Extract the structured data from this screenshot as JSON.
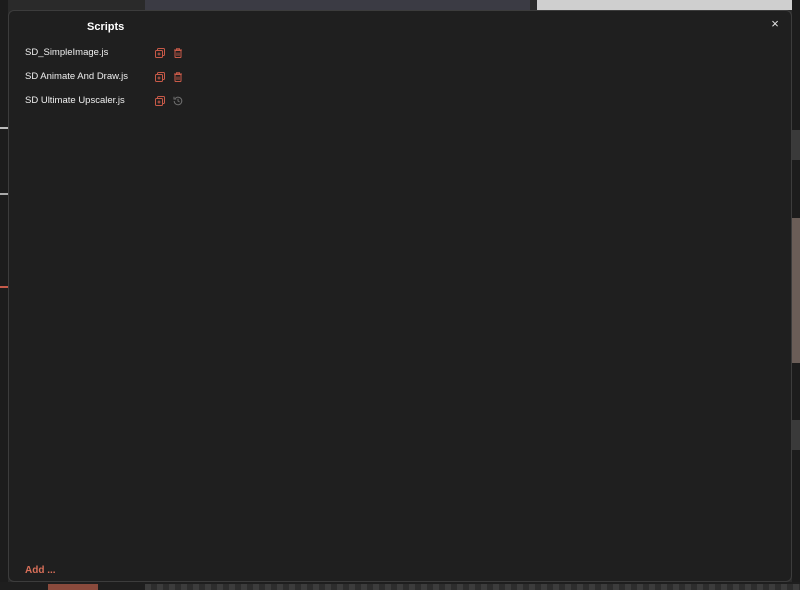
{
  "modal": {
    "title": "Scripts",
    "close_label": "×",
    "add_label": "Add ...",
    "scripts": [
      {
        "name": "SD_SimpleImage.js",
        "actions": [
          "duplicate-icon",
          "trash-icon"
        ]
      },
      {
        "name": "SD Animate And Draw.js",
        "actions": [
          "duplicate-icon",
          "trash-icon"
        ]
      },
      {
        "name": "SD Ultimate Upscaler.js",
        "actions": [
          "duplicate-icon",
          "history-icon"
        ]
      }
    ]
  },
  "colors": {
    "accent": "#d86f59",
    "modal_bg": "#1f1f1f",
    "icon_red": "#c85a48",
    "icon_grey": "#6e6e6e"
  }
}
